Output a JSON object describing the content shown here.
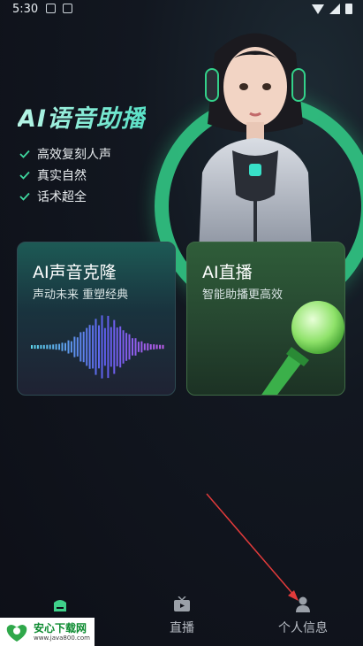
{
  "status_bar": {
    "time": "5:30"
  },
  "hero": {
    "title": "AI语音助播",
    "features": [
      "高效复刻人声",
      "真实自然",
      "话术超全"
    ]
  },
  "cards": [
    {
      "title": "AI声音克隆",
      "subtitle": "声动未来 重塑经典"
    },
    {
      "title": "AI直播",
      "subtitle": "智能助播更高效"
    }
  ],
  "bottom_nav": {
    "items": [
      {
        "label": "",
        "icon": "home-icon",
        "active": true
      },
      {
        "label": "直播",
        "icon": "tv-icon"
      },
      {
        "label": "个人信息",
        "icon": "person-icon"
      }
    ]
  },
  "watermark": {
    "name": "安心下载网",
    "url": "www.java800.com"
  },
  "colors": {
    "accent": "#33d18a",
    "ring": "#33d18a",
    "background": "#121720"
  }
}
